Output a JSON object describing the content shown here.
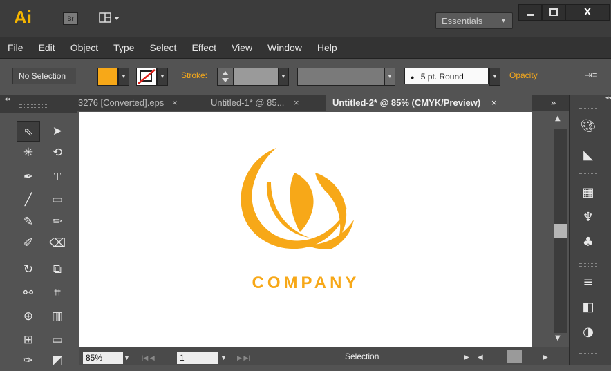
{
  "app": {
    "logo_text": "Ai",
    "bridge_label": "Br",
    "workspace": "Essentials"
  },
  "window_controls": {
    "close_label": "X"
  },
  "menus": [
    "File",
    "Edit",
    "Object",
    "Type",
    "Select",
    "Effect",
    "View",
    "Window",
    "Help"
  ],
  "control_bar": {
    "selection_status": "No Selection",
    "stroke_label": "Stroke:",
    "brush_value": "5 pt. Round",
    "opacity_label": "Opacity"
  },
  "tabs": [
    {
      "label": "3276 [Converted].eps",
      "close": "×"
    },
    {
      "label": "Untitled-1* @ 85...",
      "close": "×"
    },
    {
      "label": "Untitled-2* @ 85% (CMYK/Preview)",
      "close": "×"
    }
  ],
  "tabs_overflow": "»",
  "artboard": {
    "company_text": "COMPANY",
    "logo_color": "#F7A818"
  },
  "status_bar": {
    "zoom": "85%",
    "page": "1",
    "status": "Selection"
  },
  "colors": {
    "fill": "#F7A818",
    "accent": "#F4A81C"
  }
}
